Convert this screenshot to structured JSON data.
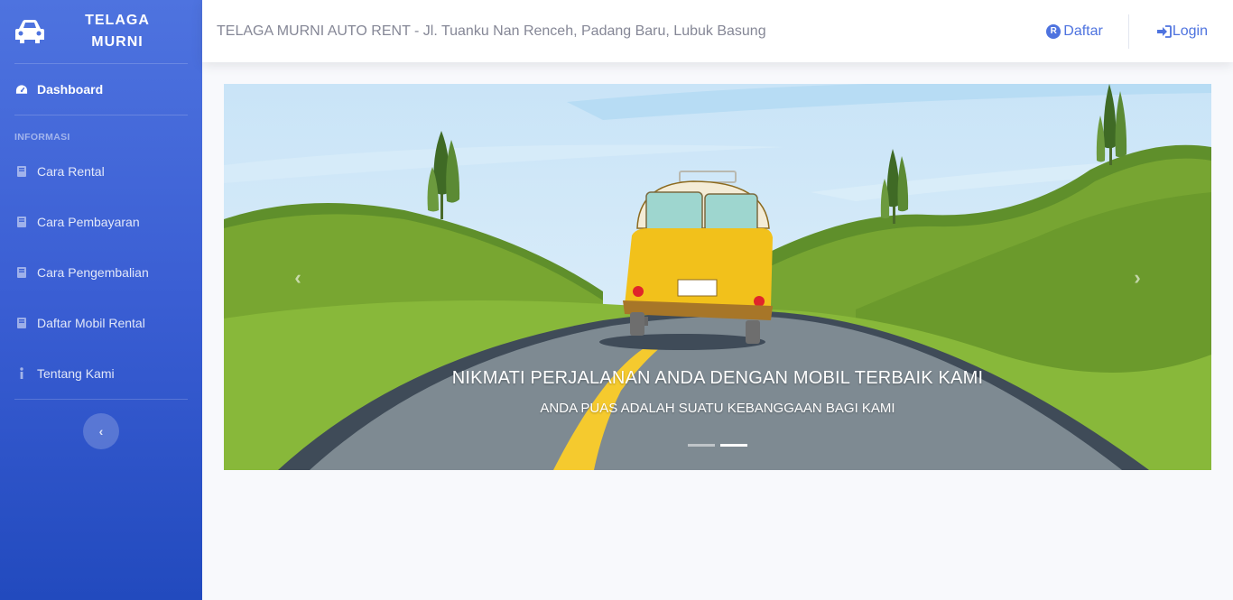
{
  "sidebar": {
    "brand": {
      "line1": "TELAGA",
      "line2": "MURNI",
      "icon": "car-icon"
    },
    "dashboard": {
      "label": "Dashboard",
      "icon": "tachometer-icon"
    },
    "heading": "INFORMASI",
    "items": [
      {
        "label": "Cara Rental",
        "icon": "book-icon"
      },
      {
        "label": "Cara Pembayaran",
        "icon": "book-icon"
      },
      {
        "label": "Cara Pengembalian",
        "icon": "book-icon"
      },
      {
        "label": "Daftar Mobil Rental",
        "icon": "book-icon"
      },
      {
        "label": "Tentang Kami",
        "icon": "info-icon"
      }
    ],
    "toggle": {
      "symbol": "‹"
    }
  },
  "topbar": {
    "title": "TELAGA MURNI AUTO RENT - Jl. Tuanku Nan Renceh, Padang Baru, Lubuk Basung",
    "daftar": {
      "badge": "R",
      "label": "Daftar"
    },
    "login": {
      "label": "Login",
      "icon": "sign-in-icon"
    }
  },
  "carousel": {
    "title": "NIKMATI PERJALANAN ANDA DENGAN MOBIL TERBAIK KAMI",
    "subtitle": "ANDA PUAS ADALAH SUATU KEBANGGAAN BAGI KAMI",
    "prev_symbol": "‹",
    "next_symbol": "›",
    "slides": 2,
    "active_slide": 2
  },
  "colors": {
    "primary": "#4e73df",
    "sidebar_bottom": "#224abe",
    "sky": "#cfe7f8",
    "grass": "#7aa831",
    "road": "#7e8a92",
    "van_yellow": "#f2c11b"
  }
}
